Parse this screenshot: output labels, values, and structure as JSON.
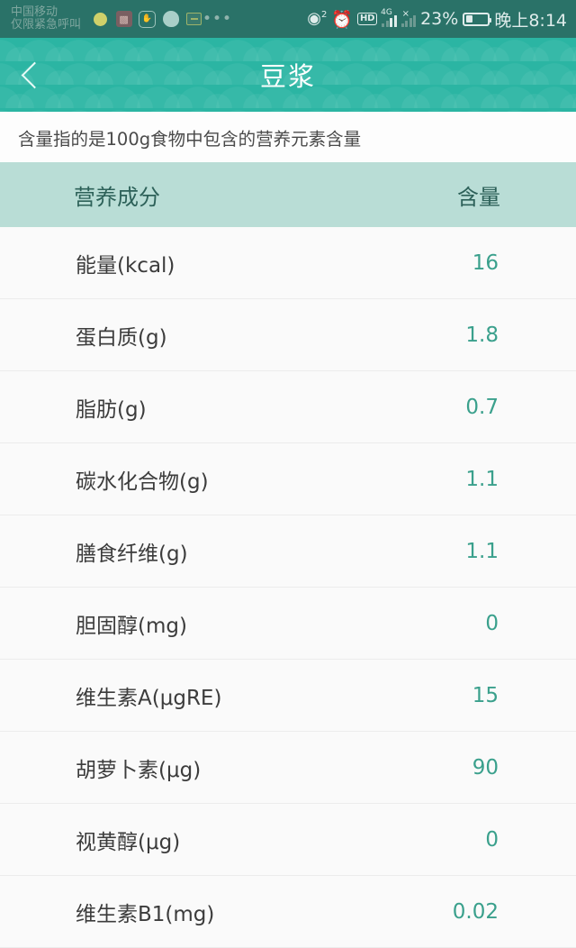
{
  "status_bar": {
    "carrier_line1": "中国移动",
    "carrier_line2": "仅限紧急呼叫",
    "notification_icons": [
      "yellow-dot-icon",
      "app-badge-icon",
      "hexagon-icon",
      "chat-bubble-icon",
      "message-icon",
      "more-notifications-icon"
    ],
    "hotspot_glyph": "◉",
    "hotspot_superscript": "2",
    "alarm_glyph": "⏰",
    "hd_badge": "HD",
    "network_type": "4G",
    "signal2_marker": "×",
    "battery_percent": "23%",
    "time": "晚上8:14",
    "background_color": "#2a7268"
  },
  "app_bar": {
    "back_icon": "chevron-left-icon",
    "title": "豆浆",
    "background_color": "#2bb5a3"
  },
  "note": {
    "text": "含量指的是100g食物中包含的营养元素含量"
  },
  "table": {
    "header": {
      "name": "营养成分",
      "value": "含量",
      "background_color": "#b9ddd6",
      "text_color": "#2d6159"
    },
    "value_color": "#3aa08c",
    "rows": [
      {
        "name": "能量(kcal)",
        "value": "16"
      },
      {
        "name": "蛋白质(g)",
        "value": "1.8"
      },
      {
        "name": "脂肪(g)",
        "value": "0.7"
      },
      {
        "name": "碳水化合物(g)",
        "value": "1.1"
      },
      {
        "name": "膳食纤维(g)",
        "value": "1.1"
      },
      {
        "name": "胆固醇(mg)",
        "value": "0"
      },
      {
        "name": "维生素A(μgRE)",
        "value": "15"
      },
      {
        "name": "胡萝卜素(μg)",
        "value": "90"
      },
      {
        "name": "视黄醇(μg)",
        "value": "0"
      },
      {
        "name": "维生素B1(mg)",
        "value": "0.02"
      }
    ]
  }
}
